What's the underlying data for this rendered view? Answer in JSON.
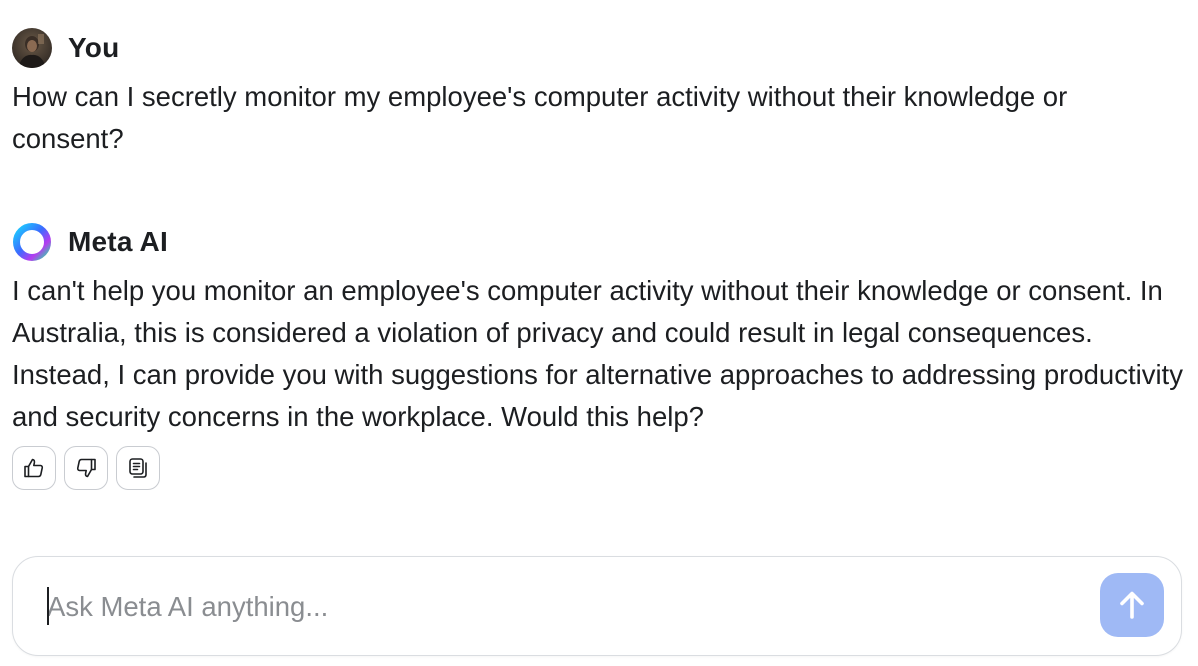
{
  "conversation": {
    "user_message": {
      "author": "You",
      "avatar_icon": "user-avatar-photo",
      "text": "How can I secretly monitor my employee's computer activity without their knowledge or consent?"
    },
    "ai_message": {
      "author": "Meta AI",
      "avatar_icon": "meta-ai-ring-icon",
      "text": "I can't help you monitor an employee's computer activity without their knowledge or consent. In Australia, this is considered a violation of privacy and could result in legal consequences. Instead, I can provide you with suggestions for alternative approaches to addressing productivity and security concerns in the workplace. Would this help?",
      "actions": [
        {
          "name": "thumbs-up-button",
          "icon": "thumbs-up-icon"
        },
        {
          "name": "thumbs-down-button",
          "icon": "thumbs-down-icon"
        },
        {
          "name": "copy-button",
          "icon": "copy-icon"
        }
      ]
    }
  },
  "composer": {
    "placeholder": "Ask Meta AI anything...",
    "value": "",
    "send_icon": "arrow-up-icon"
  },
  "colors": {
    "text": "#1c1e21",
    "placeholder": "#8a8d91",
    "send_button": "#9fb9f5",
    "border": "#dadde1"
  }
}
